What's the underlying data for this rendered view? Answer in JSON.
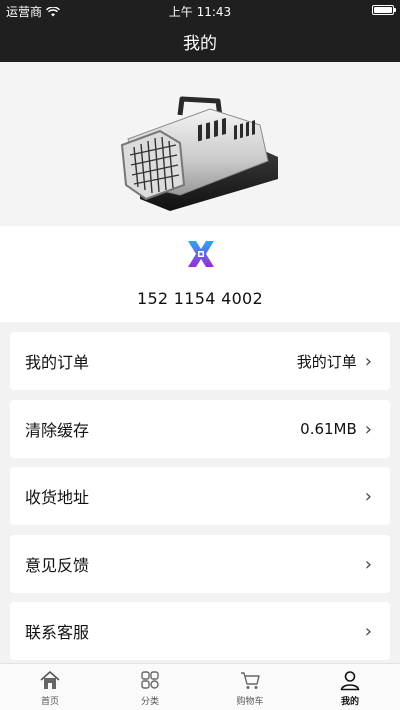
{
  "status_bar": {
    "carrier": "运营商",
    "time": "上午 11:43"
  },
  "nav": {
    "title": "我的"
  },
  "profile": {
    "phone": "152 1154 4002"
  },
  "menu": [
    {
      "label": "我的订单",
      "value": "我的订单"
    },
    {
      "label": "清除缓存",
      "value": "0.61MB"
    },
    {
      "label": "收货地址",
      "value": ""
    },
    {
      "label": "意见反馈",
      "value": ""
    },
    {
      "label": "联系客服",
      "value": ""
    }
  ],
  "tabs": [
    {
      "label": "首页",
      "icon": "home-icon"
    },
    {
      "label": "分类",
      "icon": "category-icon"
    },
    {
      "label": "购物车",
      "icon": "cart-icon"
    },
    {
      "label": "我的",
      "icon": "user-icon",
      "active": true
    }
  ],
  "colors": {
    "bar": "#1f1f1f",
    "background": "#f2f2f2",
    "logo_top": "#2aa7f0",
    "logo_bottom": "#9b2ad8"
  }
}
